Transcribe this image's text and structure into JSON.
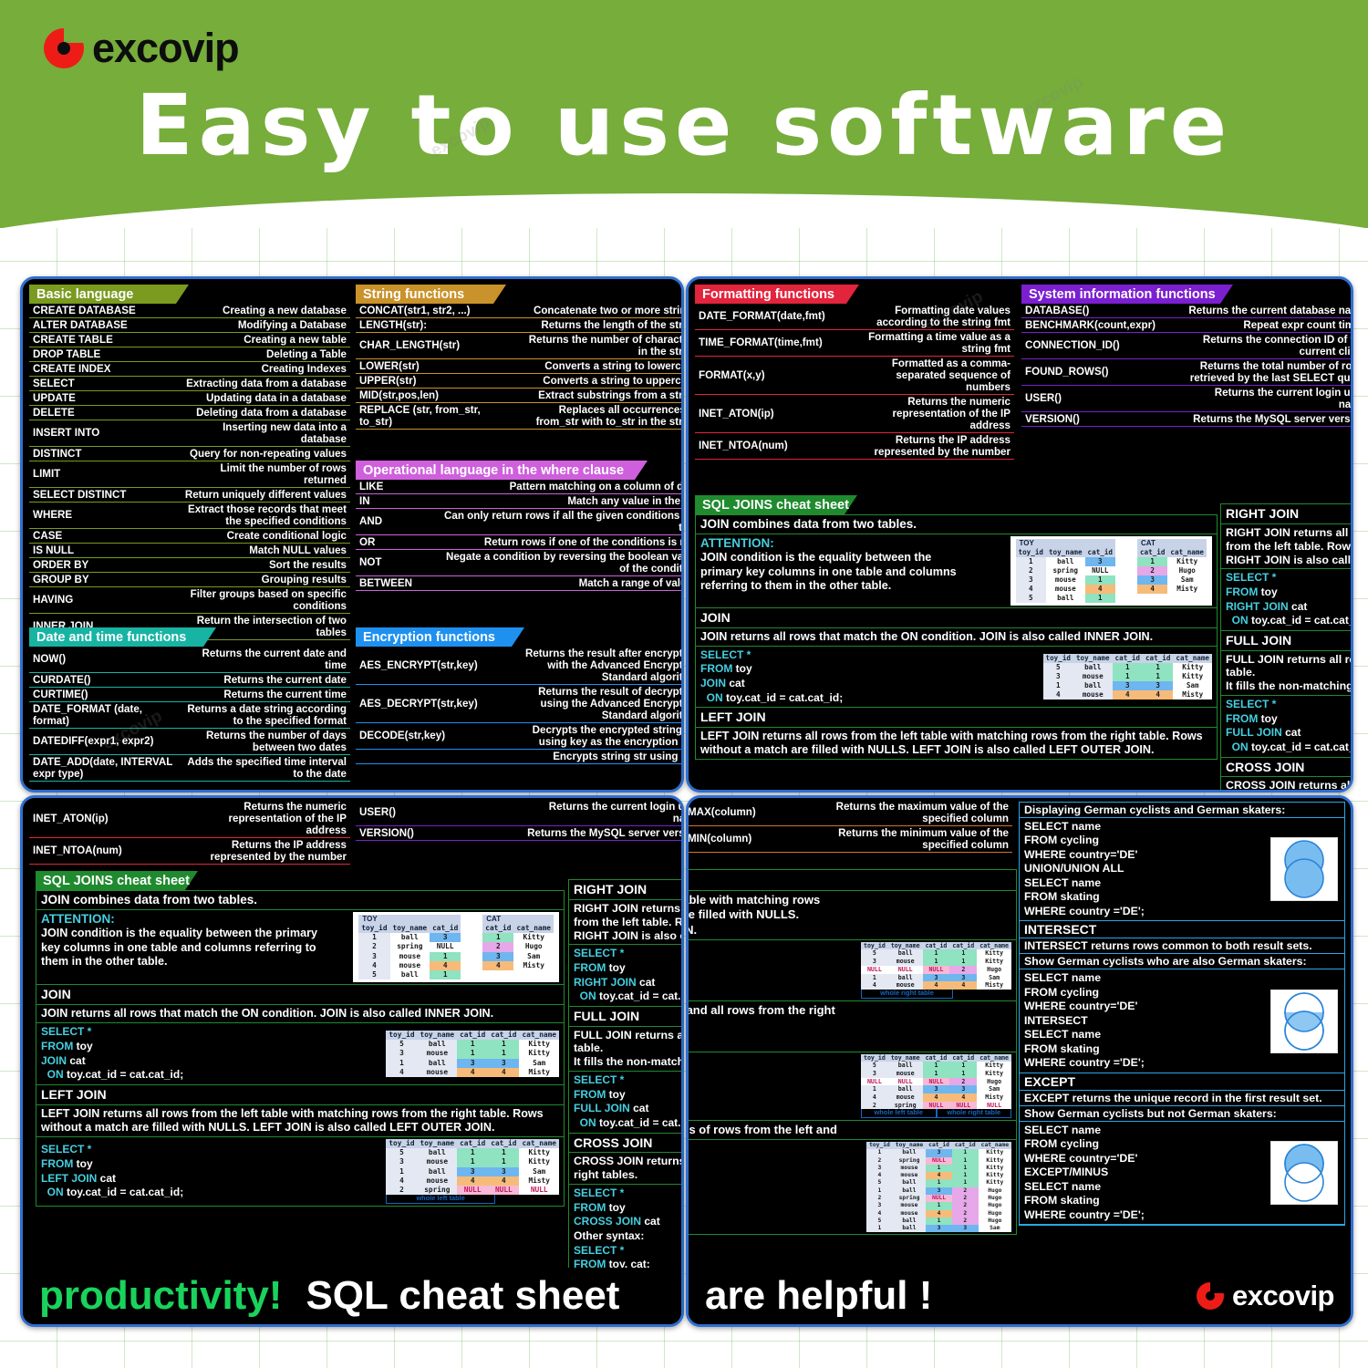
{
  "brand": {
    "name": "excovip",
    "logo_icon": "excovip-circle-logo"
  },
  "header": {
    "title": "Easy to use software",
    "bg_color": "#76ad3b"
  },
  "watermark_text": "excovip",
  "sections": {
    "basic_language": {
      "title": "Basic language",
      "color": "#7a9a20",
      "rows": [
        [
          "CREATE DATABASE",
          "Creating a new database"
        ],
        [
          "ALTER DATABASE",
          "Modifying a Database"
        ],
        [
          "CREATE TABLE",
          "Creating a new table"
        ],
        [
          "DROP TABLE",
          "Deleting a Table"
        ],
        [
          "CREATE INDEX",
          "Creating Indexes"
        ],
        [
          "SELECT",
          "Extracting data from a database"
        ],
        [
          "UPDATE",
          "Updating data in a database"
        ],
        [
          "DELETE",
          "Deleting data from a database"
        ],
        [
          "INSERT INTO",
          "Inserting new data into a database"
        ],
        [
          "DISTINCT",
          "Query for non-repeating values"
        ],
        [
          "LIMIT",
          "Limit the number of rows returned"
        ],
        [
          "SELECT DISTINCT",
          "Return uniquely different values"
        ],
        [
          "WHERE",
          "Extract those records that meet the specified conditions"
        ],
        [
          "CASE",
          "Create conditional logic"
        ],
        [
          "IS NULL",
          "Match NULL values"
        ],
        [
          "ORDER BY",
          "Sort the results"
        ],
        [
          "GROUP BY",
          "Grouping results"
        ],
        [
          "HAVING",
          "Filter groups based on specific conditions"
        ],
        [
          "INNER JOIN",
          "Return the intersection of two tables"
        ]
      ]
    },
    "date_time": {
      "title": "Date and time functions",
      "color": "#17b3a3",
      "rows": [
        [
          "NOW()",
          "Returns the current date and time"
        ],
        [
          "CURDATE()",
          "Returns the current date"
        ],
        [
          "CURTIME()",
          "Returns the current time"
        ],
        [
          "DATE_FORMAT (date, format)",
          "Returns a date string according to the specified format"
        ],
        [
          "DATEDIFF(expr1, expr2)",
          "Returns the number of days between two dates"
        ],
        [
          "DATE_ADD(date, INTERVAL expr type)",
          "Adds the specified time interval to the date"
        ]
      ]
    },
    "string_functions": {
      "title": "String functions",
      "color": "#c9922a",
      "rows": [
        [
          "CONCAT(str1, str2, ...)",
          "Concatenate two or more strings"
        ],
        [
          "LENGTH(str):",
          "Returns the length of the string"
        ],
        [
          "CHAR_LENGTH(str)",
          "Returns the number of characters in the string"
        ],
        [
          "LOWER(str)",
          "Converts a string to lowercase"
        ],
        [
          "UPPER(str)",
          "Converts a string to uppercase"
        ],
        [
          "MID(str,pos,len)",
          "Extract substrings from a string"
        ],
        [
          "REPLACE (str, from_str, to_str)",
          "Replaces all occurrences of from_str with to_str in the string"
        ]
      ]
    },
    "operational_language": {
      "title": "Operational language in the where clause",
      "color": "#cf5fdd",
      "rows": [
        [
          "LIKE",
          "Pattern matching on a column of data"
        ],
        [
          "IN",
          "Match any value in the list"
        ],
        [
          "AND",
          "Can only return rows if all the given conditions are true"
        ],
        [
          "OR",
          "Return rows if one of the conditions is met"
        ],
        [
          "NOT",
          "Negate a condition by reversing the boolean value of the condition"
        ],
        [
          "BETWEEN",
          "Match a range of values"
        ]
      ]
    },
    "encryption_functions": {
      "title": "Encryption functions",
      "color": "#1e90f0",
      "rows": [
        [
          "AES_ENCRYPT(str,key)",
          "Returns the result after encryption with the Advanced Encryption Standard algorithm"
        ],
        [
          "AES_DECRYPT(str,key)",
          "Returns the result of decryption using the Advanced Encryption Standard algorithm"
        ],
        [
          "DECODE(str,key)",
          "Decrypts the encrypted string str using key as the encryption key"
        ],
        [
          "",
          "Encrypts string str using key"
        ]
      ]
    },
    "formatting_functions": {
      "title": "Formatting functions",
      "color": "#e2243c",
      "rows": [
        [
          "DATE_FORMAT(date,fmt)",
          "Formatting date values according to the string fmt"
        ],
        [
          "TIME_FORMAT(time,fmt)",
          "Formatting a time value as a string fmt"
        ],
        [
          "FORMAT(x,y)",
          "Formatted as a comma-separated sequence of numbers"
        ],
        [
          "INET_ATON(ip)",
          "Returns the numeric representation of the IP address"
        ],
        [
          "INET_NTOA(num)",
          "Returns the IP address represented by the number"
        ]
      ]
    },
    "system_information": {
      "title": "System information functions",
      "color": "#7b1fd0",
      "rows": [
        [
          "DATABASE()",
          "Returns the current database name"
        ],
        [
          "BENCHMARK(count,expr)",
          "Repeat expr count times"
        ],
        [
          "CONNECTION_ID()",
          "Returns the connection ID of the current client"
        ],
        [
          "FOUND_ROWS()",
          "Returns the total number of rows retrieved by the last SELECT query"
        ],
        [
          "USER()",
          "Returns the current login user name"
        ],
        [
          "VERSION()",
          "Returns the MySQL server version"
        ]
      ]
    },
    "aggregate_clipped": {
      "rows": [
        [
          "MAX(column)",
          "Returns the maximum value of the specified column"
        ],
        [
          "MIN(column)",
          "Returns the minimum value of the specified column"
        ]
      ]
    }
  },
  "joins": {
    "title": "SQL JOINS cheat sheet",
    "title_color": "#1f8a2e",
    "intro": "JOIN combines data from two tables.",
    "attention_label": "ATTENTION:",
    "attention_text": "JOIN condition is the equality between the primary key columns in one table and columns referring to them in the other table.",
    "toy_table": {
      "name": "TOY",
      "headers": [
        "toy_id",
        "toy_name",
        "cat_id"
      ],
      "rows": [
        [
          "1",
          "ball",
          "3"
        ],
        [
          "2",
          "spring",
          "NULL"
        ],
        [
          "3",
          "mouse",
          "1"
        ],
        [
          "4",
          "mouse",
          "4"
        ],
        [
          "5",
          "ball",
          "1"
        ]
      ]
    },
    "cat_table": {
      "name": "CAT",
      "headers": [
        "cat_id",
        "cat_name"
      ],
      "rows": [
        [
          "1",
          "Kitty"
        ],
        [
          "2",
          "Hugo"
        ],
        [
          "3",
          "Sam"
        ],
        [
          "4",
          "Misty"
        ]
      ]
    },
    "join": {
      "title": "JOIN",
      "desc": "JOIN returns all rows that match the ON condition.  JOIN is also called INNER JOIN.",
      "code": [
        "SELECT *",
        "FROM toy",
        "JOIN cat",
        "  ON  toy.cat_id = cat.cat_id;"
      ],
      "result_headers": [
        "toy_id",
        "toy_name",
        "cat_id",
        "cat_id",
        "cat_name"
      ],
      "result_rows": [
        [
          "5",
          "ball",
          "1",
          "1",
          "Kitty"
        ],
        [
          "3",
          "mouse",
          "1",
          "1",
          "Kitty"
        ],
        [
          "1",
          "ball",
          "3",
          "3",
          "Sam"
        ],
        [
          "4",
          "mouse",
          "4",
          "4",
          "Misty"
        ]
      ]
    },
    "left_join": {
      "title": "LEFT JOIN",
      "desc": "LEFT JOIN returns all rows from the left table with matching rows from the right table. Rows without a match are filled with NULLS. LEFT JOIN is also called LEFT OUTER JOIN.",
      "code": [
        "SELECT *",
        "FROM toy",
        "LEFT JOIN cat",
        "  ON  toy.cat_id = cat.cat_id;"
      ],
      "result_headers": [
        "toy_id",
        "toy_name",
        "cat_id",
        "cat_id",
        "cat_name"
      ],
      "result_rows": [
        [
          "5",
          "ball",
          "1",
          "1",
          "Kitty"
        ],
        [
          "3",
          "mouse",
          "1",
          "1",
          "Kitty"
        ],
        [
          "1",
          "ball",
          "3",
          "3",
          "Sam"
        ],
        [
          "4",
          "mouse",
          "4",
          "4",
          "Misty"
        ],
        [
          "2",
          "spring",
          "NULL",
          "NULL",
          "NULL"
        ]
      ],
      "caption": "whole left table"
    },
    "right_join": {
      "title": "RIGHT JOIN",
      "desc_lines": [
        "RIGHT JOIN returns all rows from the right table with matching rows",
        "from the left table. Rows without a match are filled with NULLS.",
        "RIGHT JOIN is also called RIGHT OUTER JOIN."
      ],
      "code": [
        "SELECT *",
        "FROM toy",
        "RIGHT JOIN cat",
        "  ON  toy.cat_id = cat.cat_id;"
      ],
      "result_headers": [
        "toy_id",
        "toy_name",
        "cat_id",
        "cat_id",
        "cat_name"
      ],
      "result_rows": [
        [
          "5",
          "ball",
          "1",
          "1",
          "Kitty"
        ],
        [
          "3",
          "mouse",
          "1",
          "1",
          "Kitty"
        ],
        [
          "NULL",
          "NULL",
          "NULL",
          "2",
          "Hugo"
        ],
        [
          "1",
          "ball",
          "3",
          "3",
          "Sam"
        ],
        [
          "4",
          "mouse",
          "4",
          "4",
          "Misty"
        ]
      ],
      "caption": "whole right table"
    },
    "full_join": {
      "title": "FULL JOIN",
      "desc_lines": [
        "FULL JOIN returns all rows from the left  table and all rows from the right",
        "table.",
        "It fills the non-matching rows with NULLS."
      ],
      "code": [
        "SELECT *",
        "FROM toy",
        "FULL JOIN cat",
        "  ON  toy.cat_id = cat.cat_id;"
      ],
      "result_headers": [
        "toy_id",
        "toy_name",
        "cat_id",
        "cat_id",
        "cat_name"
      ],
      "result_rows": [
        [
          "5",
          "ball",
          "1",
          "1",
          "Kitty"
        ],
        [
          "3",
          "mouse",
          "1",
          "1",
          "Kitty"
        ],
        [
          "NULL",
          "NULL",
          "NULL",
          "2",
          "Hugo"
        ],
        [
          "1",
          "ball",
          "3",
          "3",
          "Sam"
        ],
        [
          "4",
          "mouse",
          "4",
          "4",
          "Misty"
        ],
        [
          "2",
          "spring",
          "NULL",
          "NULL",
          "NULL"
        ]
      ],
      "caption_left": "whole left table",
      "caption_right": "whole right table"
    },
    "cross_join": {
      "title": "CROSS JOIN",
      "desc_lines": [
        "CROSS JOIN returns all possible combinations of rows from the left and",
        "right tables."
      ],
      "code": [
        "SELECT *",
        "FROM toy",
        "CROSS  JOIN cat"
      ],
      "other_label": "Other syntax:",
      "code2": [
        "SELECT *",
        "FROM toy, cat;"
      ],
      "result_headers": [
        "toy_id",
        "toy_name",
        "cat_id",
        "cat_id",
        "cat_name"
      ],
      "result_rows": [
        [
          "1",
          "ball",
          "3",
          "1",
          "Kitty"
        ],
        [
          "2",
          "spring",
          "NULL",
          "1",
          "Kitty"
        ],
        [
          "3",
          "mouse",
          "1",
          "1",
          "Kitty"
        ],
        [
          "4",
          "mouse",
          "4",
          "1",
          "Kitty"
        ],
        [
          "5",
          "ball",
          "1",
          "1",
          "Kitty"
        ],
        [
          "1",
          "ball",
          "3",
          "2",
          "Hugo"
        ],
        [
          "2",
          "spring",
          "NULL",
          "2",
          "Hugo"
        ],
        [
          "3",
          "mouse",
          "1",
          "2",
          "Hugo"
        ],
        [
          "4",
          "mouse",
          "4",
          "2",
          "Hugo"
        ],
        [
          "5",
          "ball",
          "1",
          "2",
          "Hugo"
        ],
        [
          "1",
          "ball",
          "3",
          "3",
          "Sam"
        ]
      ]
    }
  },
  "set_ops": {
    "union": {
      "header": "Displaying German cyclists and German skaters:",
      "code": [
        "SELECT name",
        "FROM cycling",
        "WHERE country='DE'",
        "UNION/UNION ALL",
        "SELECT name",
        "FROM skating",
        "WHERE country ='DE';"
      ],
      "venn": "union-venn"
    },
    "intersect": {
      "title": "INTERSECT",
      "desc": "INTERSECT returns rows common to both result sets.",
      "header": "Show German cyclists who are also German skaters:",
      "code": [
        "SELECT name",
        "FROM cycling",
        "WHERE country='DE'",
        "INTERSECT",
        "SELECT name",
        "FROM skating",
        "WHERE country ='DE';"
      ],
      "venn": "intersect-venn"
    },
    "except": {
      "title": "EXCEPT",
      "desc": "EXCEPT returns the unique record in the first result set.",
      "header": "Show German cyclists but not German skaters:",
      "code": [
        "SELECT name",
        "FROM cycling",
        "WHERE country='DE'",
        "EXCEPT/MINUS",
        "SELECT name",
        "FROM skating",
        "WHERE country ='DE';"
      ],
      "venn": "except-venn"
    }
  },
  "footers": {
    "bl_green": "productivity!",
    "bl_white": "SQL cheat sheet",
    "br_white": "are helpful !"
  }
}
